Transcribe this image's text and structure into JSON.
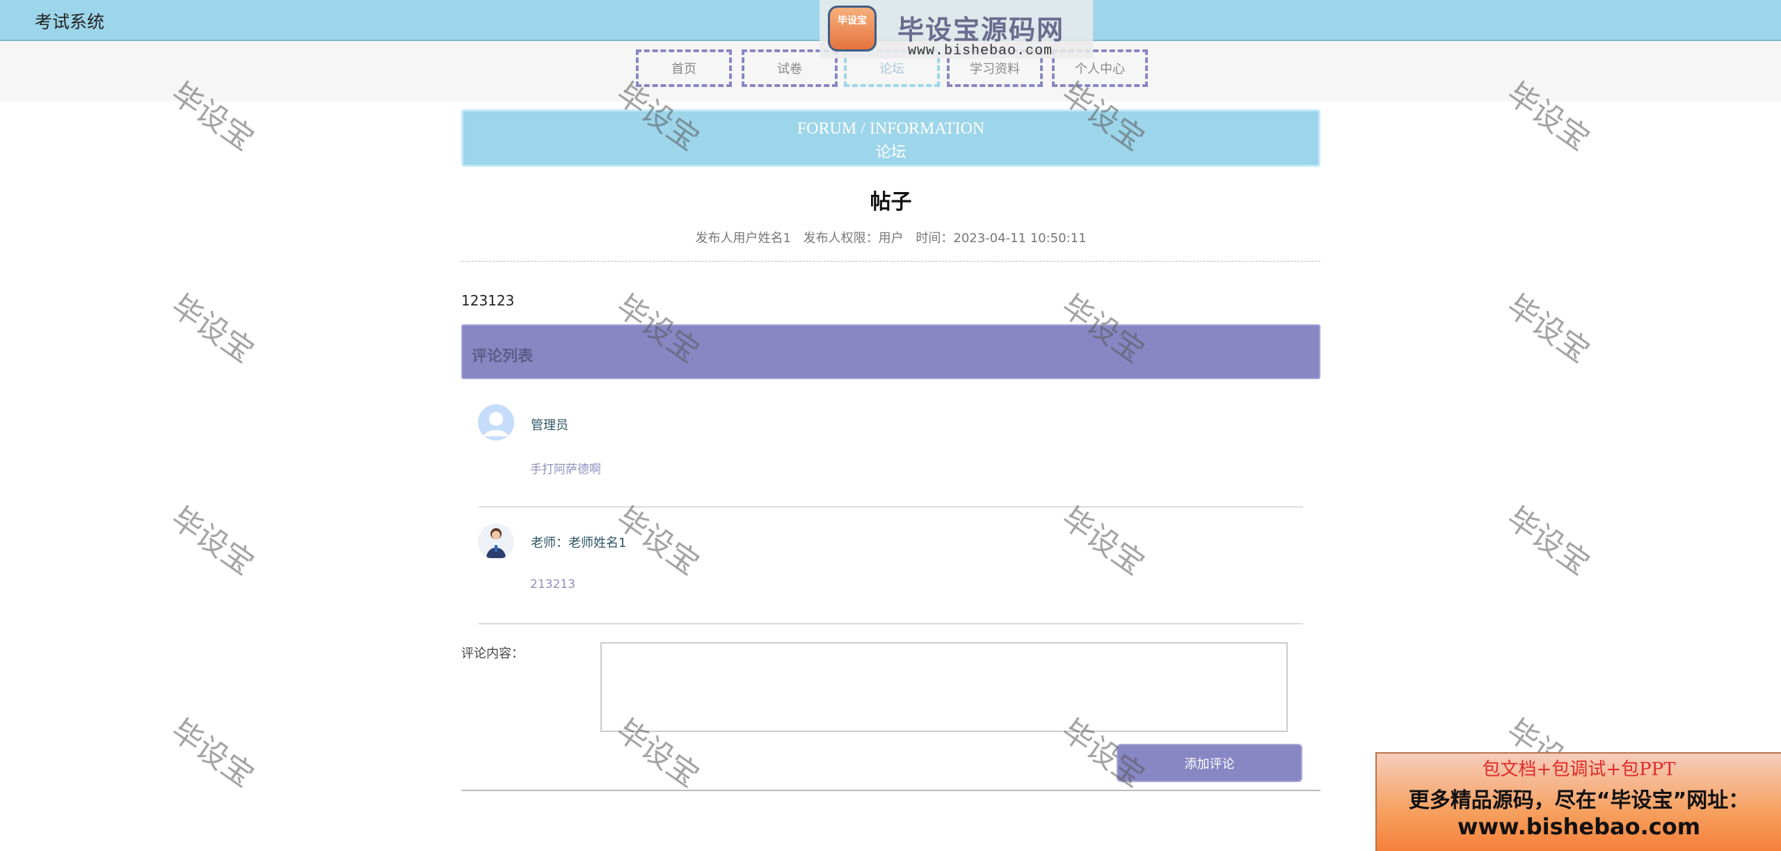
{
  "app": {
    "title": "考试系统"
  },
  "nav": {
    "items": [
      {
        "label": "首页"
      },
      {
        "label": "试卷"
      },
      {
        "label": "论坛"
      },
      {
        "label": "学习资料"
      },
      {
        "label": "个人中心"
      }
    ],
    "active": "论坛"
  },
  "banner": {
    "en": "FORUM / INFORMATION",
    "cn": "论坛"
  },
  "post": {
    "title": "帖子",
    "author": "发布人用户姓名1",
    "role": "发布人权限：用户",
    "time": "时间：2023-04-11 10:50:11",
    "content": "123123"
  },
  "comments": {
    "header": "评论列表",
    "items": [
      {
        "name": "管理员",
        "text": "手打阿萨德啊",
        "avatar": "user-icon"
      },
      {
        "name": "老师：老师姓名1",
        "text": "213213",
        "avatar": "teacher-photo"
      }
    ]
  },
  "form": {
    "label": "评论内容：",
    "placeholder": "",
    "submit_label": "添加评论"
  },
  "watermark": {
    "text": "毕设宝"
  },
  "logo": {
    "badge": "毕设宝",
    "title": "毕设宝源码网",
    "url": "www.bishebao.com"
  },
  "ad": {
    "line1": "包文档+包调试+包PPT",
    "line2": "更多精品源码，尽在“毕设宝”网址：",
    "line3": "www.bishebao.com"
  },
  "colors": {
    "accent": "#9dd5ea",
    "purple": "#8886c3"
  }
}
